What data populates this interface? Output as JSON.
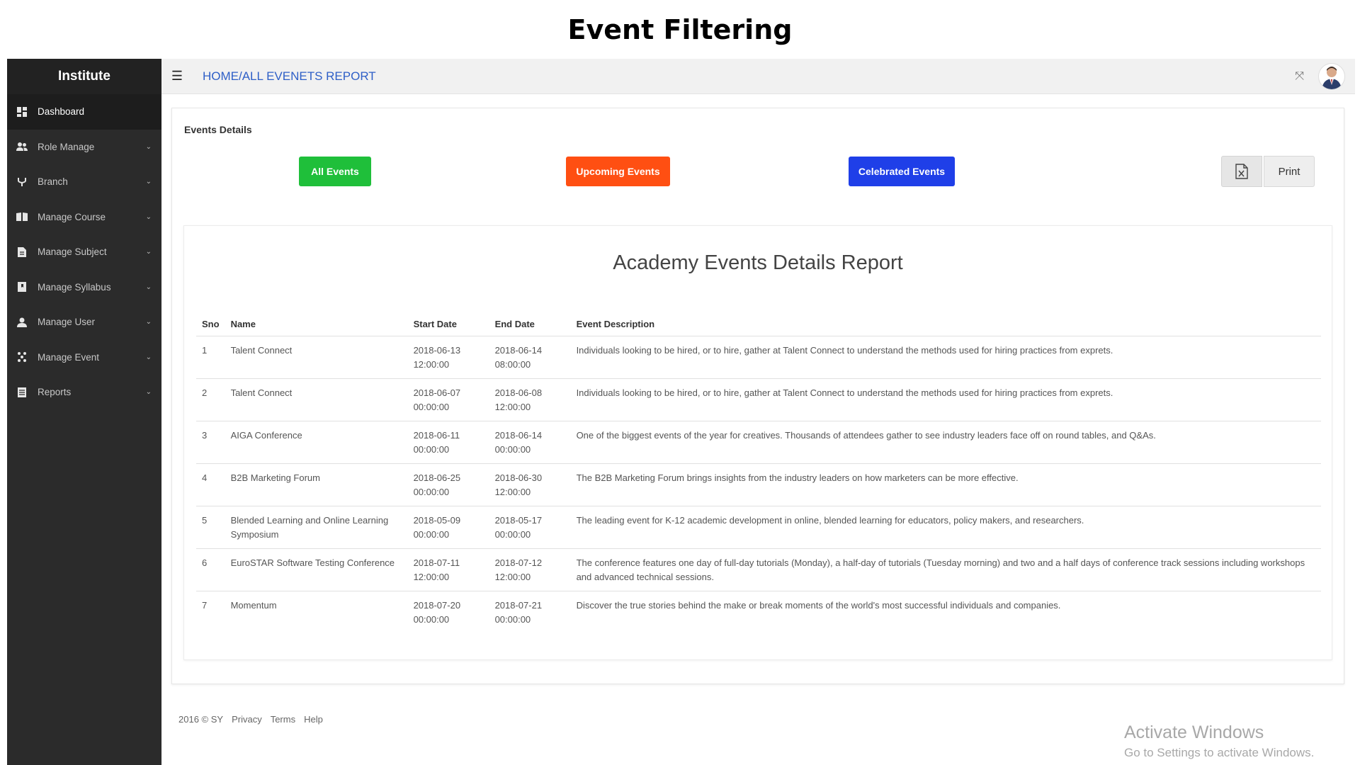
{
  "slide_title": "Event Filtering",
  "brand": "Institute",
  "sidebar": {
    "items": [
      {
        "label": "Dashboard",
        "icon": "dashboard-icon",
        "active": true,
        "has_submenu": false
      },
      {
        "label": "Role Manage",
        "icon": "users-icon",
        "active": false,
        "has_submenu": true
      },
      {
        "label": "Branch",
        "icon": "branch-icon",
        "active": false,
        "has_submenu": true
      },
      {
        "label": "Manage Course",
        "icon": "book-icon",
        "active": false,
        "has_submenu": true
      },
      {
        "label": "Manage Subject",
        "icon": "document-icon",
        "active": false,
        "has_submenu": true
      },
      {
        "label": "Manage Syllabus",
        "icon": "bookmark-icon",
        "active": false,
        "has_submenu": true
      },
      {
        "label": "Manage User",
        "icon": "user-icon",
        "active": false,
        "has_submenu": true
      },
      {
        "label": "Manage Event",
        "icon": "event-icon",
        "active": false,
        "has_submenu": true
      },
      {
        "label": "Reports",
        "icon": "list-icon",
        "active": false,
        "has_submenu": true
      }
    ]
  },
  "topbar": {
    "breadcrumb": "HOME/ALL EVENETS REPORT",
    "menu_icon": "hamburger-icon",
    "expand_icon": "expand-icon",
    "avatar_icon": "user-avatar"
  },
  "panel": {
    "heading": "Events Details",
    "buttons": {
      "all": "All Events",
      "upcoming": "Upcoming Events",
      "celebrated": "Celebrated Events",
      "print": "Print"
    },
    "colors": {
      "all": "#1fbf3a",
      "upcoming": "#ff4f12",
      "celebrated": "#1f3fe8",
      "breadcrumb": "#2e5fc7",
      "sidebar_bg": "#2b2b2b"
    }
  },
  "report": {
    "title": "Academy Events Details Report",
    "columns": [
      "Sno",
      "Name",
      "Start Date",
      "End Date",
      "Event Description"
    ],
    "rows": [
      {
        "sno": "1",
        "name": "Talent Connect",
        "start_date": "2018-06-13",
        "start_time": "12:00:00",
        "end_date": "2018-06-14",
        "end_time": "08:00:00",
        "description": "Individuals looking to be hired, or to hire, gather at Talent Connect to understand the methods used for hiring practices from exprets."
      },
      {
        "sno": "2",
        "name": "Talent Connect",
        "start_date": "2018-06-07",
        "start_time": "00:00:00",
        "end_date": "2018-06-08",
        "end_time": "12:00:00",
        "description": "Individuals looking to be hired, or to hire, gather at Talent Connect to understand the methods used for hiring practices from exprets."
      },
      {
        "sno": "3",
        "name": "AIGA Conference",
        "start_date": "2018-06-11",
        "start_time": "00:00:00",
        "end_date": "2018-06-14",
        "end_time": "00:00:00",
        "description": "One of the biggest events of the year for creatives. Thousands of attendees gather to see industry leaders face off on round tables, and Q&As."
      },
      {
        "sno": "4",
        "name": "B2B Marketing Forum",
        "start_date": "2018-06-25",
        "start_time": "00:00:00",
        "end_date": "2018-06-30",
        "end_time": "12:00:00",
        "description": "The B2B Marketing Forum brings insights from the industry leaders on how marketers can be more effective."
      },
      {
        "sno": "5",
        "name": "Blended Learning and Online Learning Symposium",
        "start_date": "2018-05-09",
        "start_time": "00:00:00",
        "end_date": "2018-05-17",
        "end_time": "00:00:00",
        "description": "The leading event for K-12 academic development in online, blended learning for educators, policy makers, and researchers."
      },
      {
        "sno": "6",
        "name": "EuroSTAR Software Testing Conference",
        "start_date": "2018-07-11",
        "start_time": "12:00:00",
        "end_date": "2018-07-12",
        "end_time": "12:00:00",
        "description": "The conference features one day of full-day tutorials (Monday), a half-day of tutorials (Tuesday morning) and two and a half days of conference track sessions including workshops and advanced technical sessions."
      },
      {
        "sno": "7",
        "name": "Momentum",
        "start_date": "2018-07-20",
        "start_time": "00:00:00",
        "end_date": "2018-07-21",
        "end_time": "00:00:00",
        "description": "Discover the true stories behind the make or break moments of the world's most successful individuals and companies."
      }
    ]
  },
  "footer": {
    "copyright": "2016 © SY",
    "links": [
      "Privacy",
      "Terms",
      "Help"
    ]
  },
  "watermark": {
    "line1": "Activate Windows",
    "line2": "Go to Settings to activate Windows."
  }
}
